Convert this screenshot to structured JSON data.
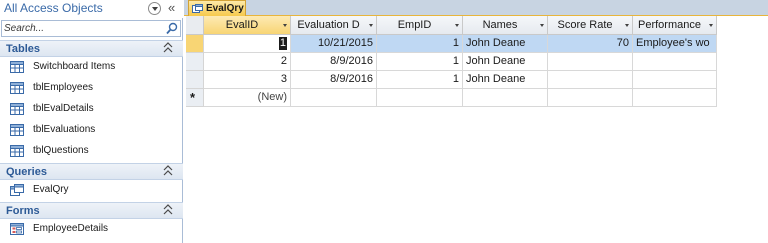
{
  "nav": {
    "title": "All Access Objects",
    "search_placeholder": "Search...",
    "groups": [
      {
        "label": "Tables",
        "items": [
          {
            "label": "Switchboard Items",
            "icon": "table-icon"
          },
          {
            "label": "tblEmployees",
            "icon": "table-icon"
          },
          {
            "label": "tblEvalDetails",
            "icon": "table-icon"
          },
          {
            "label": "tblEvaluations",
            "icon": "table-icon"
          },
          {
            "label": "tblQuestions",
            "icon": "table-icon"
          }
        ]
      },
      {
        "label": "Queries",
        "items": [
          {
            "label": "EvalQry",
            "icon": "query-icon"
          }
        ]
      },
      {
        "label": "Forms",
        "items": [
          {
            "label": "EmployeeDetails",
            "icon": "form-icon"
          }
        ]
      }
    ]
  },
  "tab": {
    "label": "EvalQry",
    "icon": "query-icon"
  },
  "datasheet": {
    "columns": [
      "EvalID",
      "Evaluation D",
      "EmpID",
      "Names",
      "Score Rate",
      "Performance"
    ],
    "rows": [
      {
        "evalid": "1",
        "date": "10/21/2015",
        "empid": "1",
        "names": "John Deane",
        "score": "70",
        "performance": "Employee's wo"
      },
      {
        "evalid": "2",
        "date": "8/9/2016",
        "empid": "1",
        "names": "John Deane",
        "score": "",
        "performance": ""
      },
      {
        "evalid": "3",
        "date": "8/9/2016",
        "empid": "1",
        "names": "John Deane",
        "score": "",
        "performance": ""
      }
    ],
    "new_row": {
      "selector": "*",
      "label": "(New)"
    }
  },
  "colors": {
    "accent": "#f8d574",
    "selected_row": "#bfd8f3",
    "nav_header_text": "#2d5a96"
  }
}
